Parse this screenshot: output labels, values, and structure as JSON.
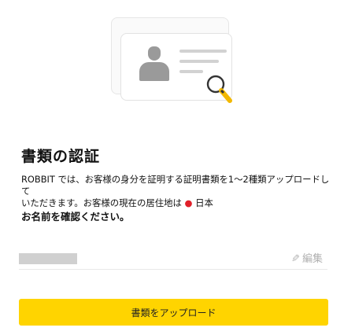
{
  "section": {
    "title": "書類の認証",
    "description_line1": "ROBBIT では、お客様の身分を証明する証明書類を1〜2種類アップロードして",
    "description_line2": "いただきます。お客様の現在の居住地は",
    "country_marker": "●",
    "country": "日本",
    "instruction": "お名前を確認ください。"
  },
  "edit_label": "編集",
  "upload_button_label": "書類をアップロード",
  "colors": {
    "accent": "#ffd400",
    "country_dot": "#e0202a",
    "placeholder": "#d0d0d0"
  },
  "icons": {
    "illustration": "id-card-illustration",
    "magnifier": "magnifier-icon",
    "edit": "pencil-icon"
  }
}
